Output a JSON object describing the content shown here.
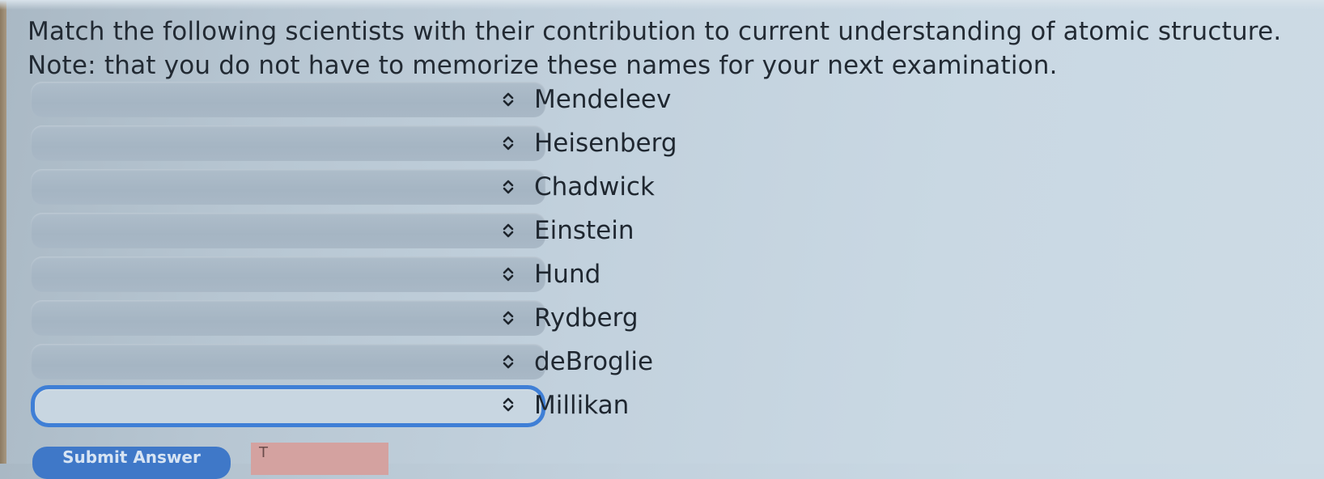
{
  "question": {
    "line1": "Match the following scientists with their contribution to current understanding of atomic structure.",
    "line2": "Note: that you do not have to memorize these names for your next examination."
  },
  "rows": [
    {
      "term": "Mendeleev",
      "selected": ""
    },
    {
      "term": "Heisenberg",
      "selected": ""
    },
    {
      "term": "Chadwick",
      "selected": ""
    },
    {
      "term": "Einstein",
      "selected": ""
    },
    {
      "term": "Hund",
      "selected": ""
    },
    {
      "term": "Rydberg",
      "selected": ""
    },
    {
      "term": "deBroglie",
      "selected": ""
    },
    {
      "term": "Millikan",
      "selected": ""
    }
  ],
  "buttons": {
    "submit_label": "Submit Answer",
    "second_label": "T"
  },
  "colors": {
    "focus_border": "#3f7fd6",
    "select_bg": "#aebdca",
    "submit_bg": "#3f78c8",
    "second_bg": "#d4a2a0"
  },
  "icons": {
    "select_indicator": "chevron-up-down-icon"
  }
}
